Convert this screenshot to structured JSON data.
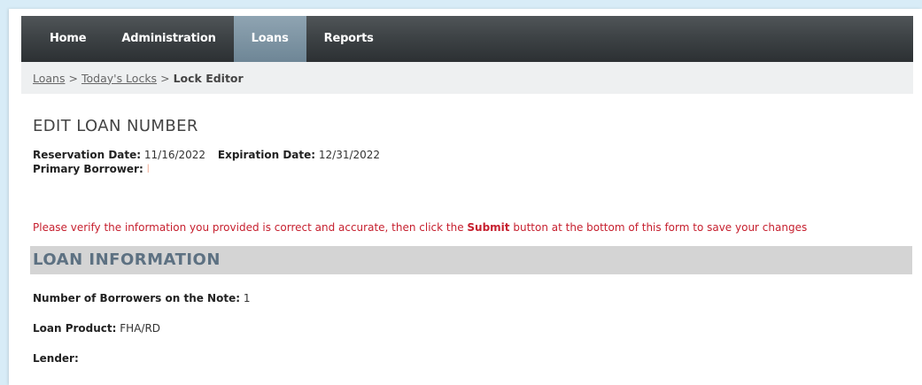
{
  "nav": {
    "tabs": [
      {
        "label": "Home",
        "active": false
      },
      {
        "label": "Administration",
        "active": false
      },
      {
        "label": "Loans",
        "active": true
      },
      {
        "label": "Reports",
        "active": false
      }
    ]
  },
  "breadcrumb": {
    "items": [
      "Loans",
      "Today's Locks"
    ],
    "separator": ">",
    "current": "Lock Editor"
  },
  "page": {
    "title": "EDIT LOAN NUMBER",
    "reservation_label": "Reservation Date:",
    "reservation_value": "11/16/2022",
    "expiration_label": "Expiration Date:",
    "expiration_value": "12/31/2022",
    "borrower_label": "Primary Borrower:",
    "borrower_value": "l",
    "notice_before": "Please verify the information you provided is correct and accurate, then click the ",
    "notice_strong": "Submit",
    "notice_after": " button at the bottom of this form to save your changes"
  },
  "loan_info": {
    "section_title": "LOAN INFORMATION",
    "borrowers_label": "Number of Borrowers on the Note:",
    "borrowers_value": "1",
    "product_label": "Loan Product:",
    "product_value": "FHA/RD",
    "lender_label": "Lender:"
  },
  "colors": {
    "accent_red": "#c61f2e",
    "section_text": "#5d7182",
    "nav_bg": "#3e4346"
  }
}
